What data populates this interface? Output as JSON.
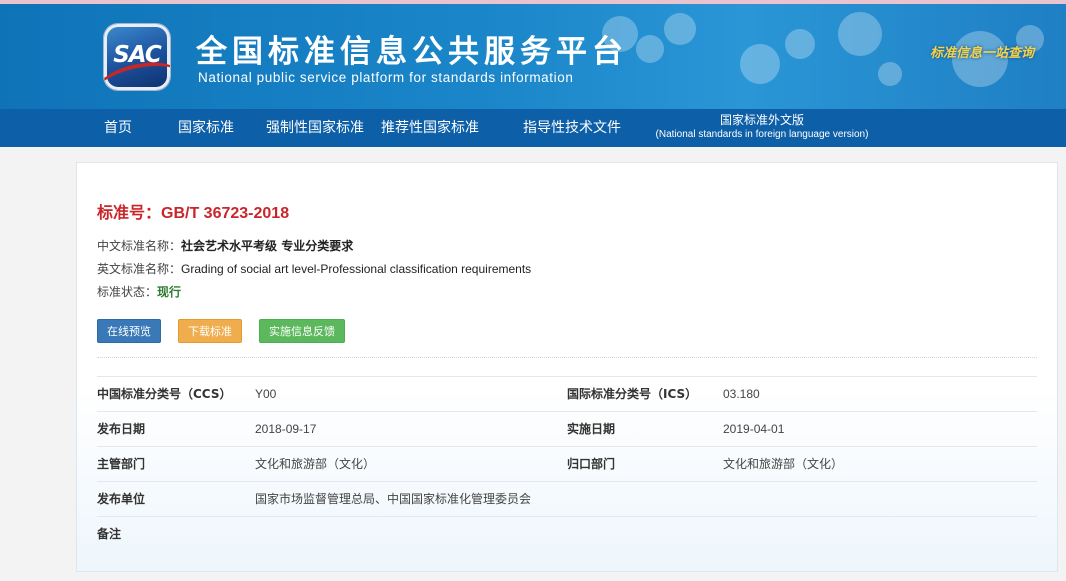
{
  "header": {
    "logo_text": "SAC",
    "title": "全国标准信息公共服务平台",
    "subtitle": "National public service platform  for standards information",
    "slogan": "标准信息一站查询"
  },
  "nav": {
    "items": [
      {
        "label": "首页"
      },
      {
        "label": "国家标准"
      },
      {
        "label": "强制性国家标准"
      },
      {
        "label": "推荐性国家标准"
      },
      {
        "label": "指导性技术文件"
      }
    ],
    "foreign_title": "国家标准外文版",
    "foreign_sub": "(National standards in foreign language version)"
  },
  "standard": {
    "number_label": "标准号：",
    "number": "GB/T 36723-2018",
    "cn_name_label": "中文标准名称：",
    "cn_name": "社会艺术水平考级 专业分类要求",
    "en_name_label": "英文标准名称：",
    "en_name": "Grading of social art level-Professional classification requirements",
    "status_label": "标准状态：",
    "status": "现行"
  },
  "actions": {
    "preview": "在线预览",
    "download": "下载标准",
    "feedback": "实施信息反馈"
  },
  "details": {
    "ccs_label": "中国标准分类号（CCS）",
    "ccs": "Y00",
    "ics_label": "国际标准分类号（ICS）",
    "ics": "03.180",
    "publish_date_label": "发布日期",
    "publish_date": "2018-09-17",
    "impl_date_label": "实施日期",
    "impl_date": "2019-04-01",
    "authority_label": "主管部门",
    "authority": "文化和旅游部（文化）",
    "centralized_label": "归口部门",
    "centralized": "文化和旅游部（文化）",
    "publisher_label": "发布单位",
    "publisher": "国家市场监督管理总局、中国国家标准化管理委员会",
    "remark_label": "备注"
  },
  "colors": {
    "banner": "#1a86c9",
    "nav": "#0d5fa8",
    "std_red": "#c9262b",
    "status_green": "#2e7d32",
    "btn_blue": "#3a79b7",
    "btn_orange": "#f0ad4e",
    "btn_green": "#5cb85c"
  }
}
